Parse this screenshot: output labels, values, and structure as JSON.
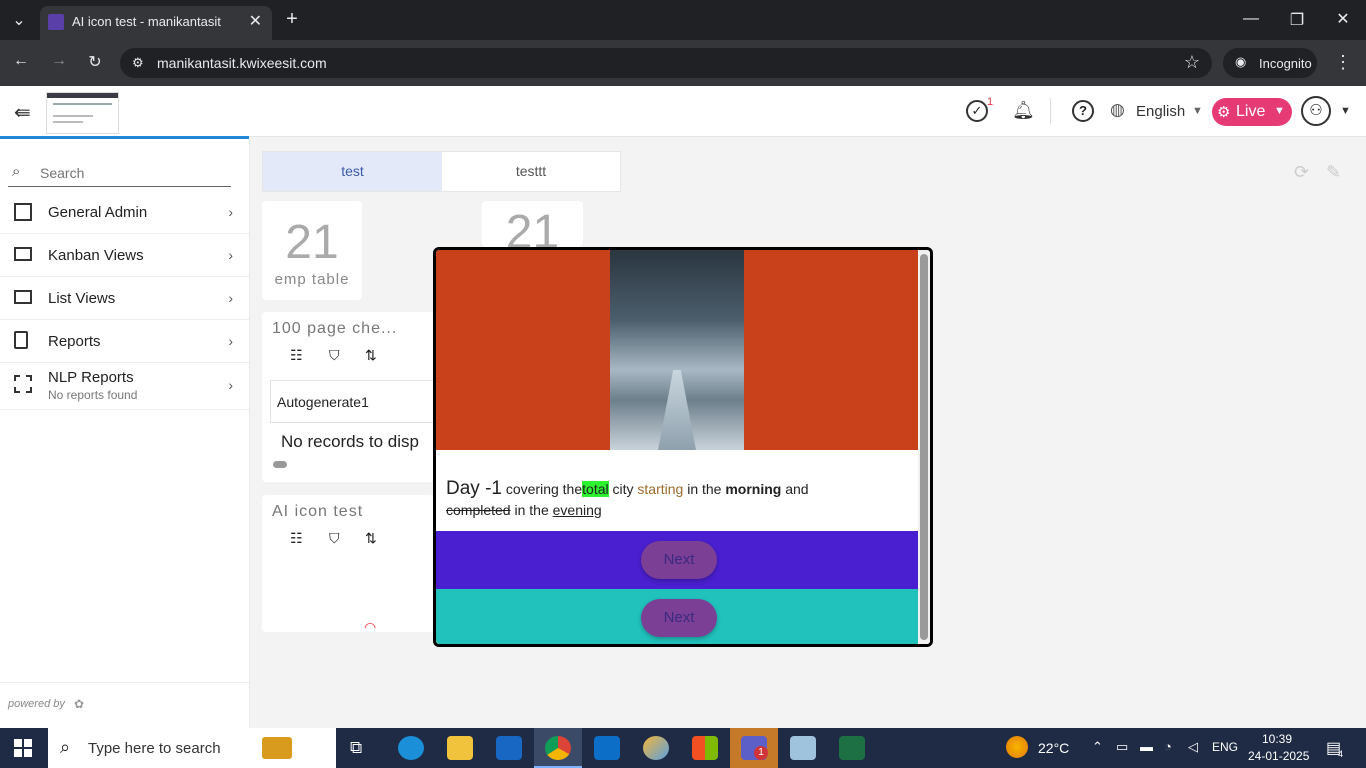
{
  "browser": {
    "tab_title": "AI icon test - manikantasit",
    "url": "manikantasit.kwixeesit.com",
    "incognito_label": "Incognito"
  },
  "header": {
    "task_count": "1",
    "language": "English",
    "live_label": "Live"
  },
  "sidebar": {
    "search_placeholder": "Search",
    "items": [
      {
        "label": "General Admin"
      },
      {
        "label": "Kanban Views"
      },
      {
        "label": "List Views"
      },
      {
        "label": "Reports"
      },
      {
        "label": "NLP Reports",
        "sub": "No reports found"
      }
    ],
    "powered_by": "powered by"
  },
  "main": {
    "tabs": [
      {
        "label": "test"
      },
      {
        "label": "testtt"
      }
    ],
    "counter1": {
      "value": "21",
      "label": "emp table"
    },
    "counter2": {
      "value": "21"
    },
    "widget1": {
      "title": "100 page che...",
      "column": "Autogenerate1",
      "empty": "No records to disp"
    },
    "widget2": {
      "title": "AI icon test"
    }
  },
  "modal": {
    "day": "Day -1",
    "text_a": "covering the",
    "text_total": "total",
    "text_city": "city",
    "text_starting": "starting",
    "text_inthe": "in the",
    "text_morning": "morning",
    "text_and": "and",
    "text_completed": "completed",
    "text_inthe2": "in the",
    "text_evening": "evening ",
    "next1": "Next",
    "next2": "Next",
    "colors": {
      "banner": "#c9411a",
      "band1": "#4a1fcf",
      "band2": "#21c1bc",
      "highlight": "#2ef22e",
      "starting": "#9a6a2a"
    }
  },
  "taskbar": {
    "search_placeholder": "Type here to search",
    "weather": "22°C",
    "lang": "ENG",
    "time": "10:39",
    "date": "24-01-2025",
    "notif_count": "4",
    "teams_badge": "1"
  }
}
